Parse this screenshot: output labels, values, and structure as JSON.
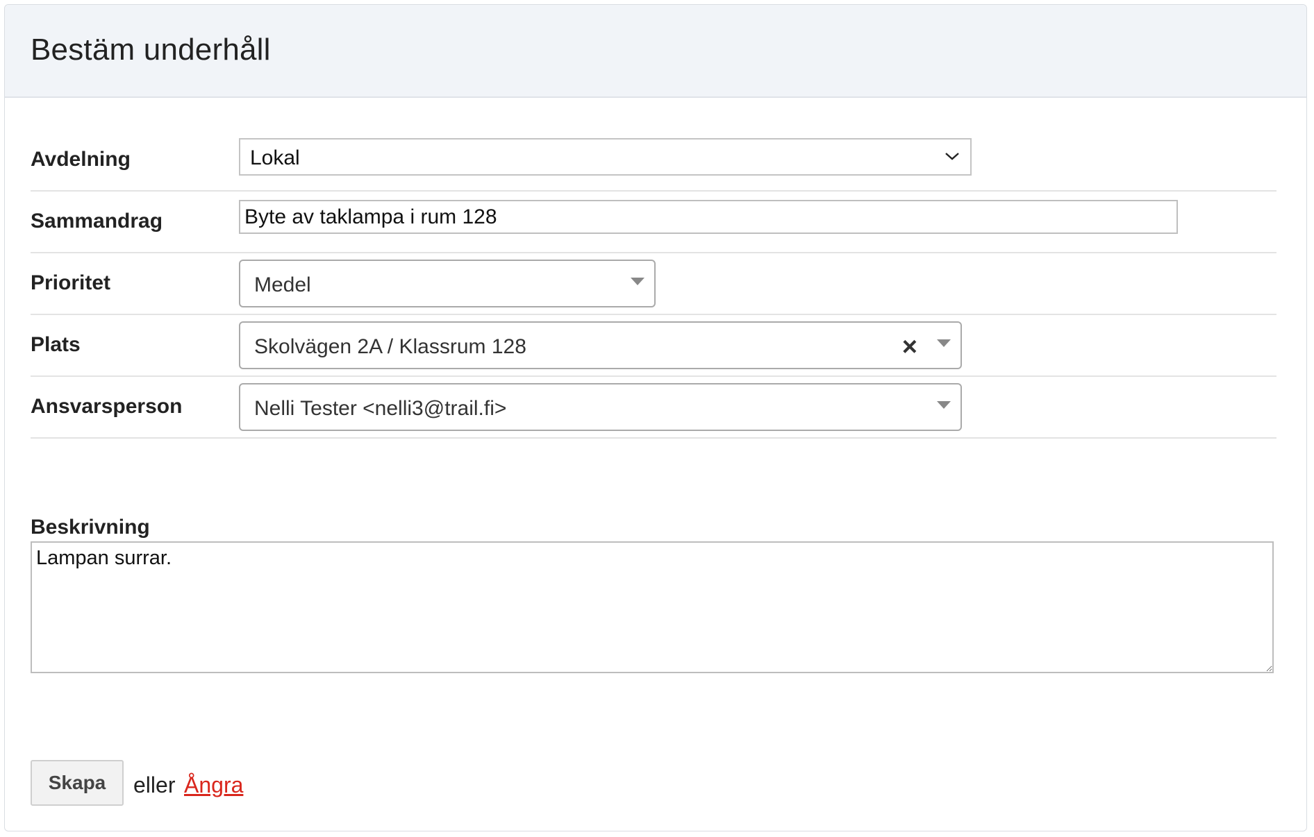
{
  "header": {
    "title": "Bestäm underhåll"
  },
  "form": {
    "department": {
      "label": "Avdelning",
      "selected": "Lokal"
    },
    "summary": {
      "label": "Sammandrag",
      "value": "Byte av taklampa i rum 128"
    },
    "priority": {
      "label": "Prioritet",
      "selected": "Medel"
    },
    "location": {
      "label": "Plats",
      "selected": "Skolvägen 2A / Klassrum 128",
      "clear_icon": "×"
    },
    "responsible": {
      "label": "Ansvarsperson",
      "selected": "Nelli Tester <nelli3@trail.fi>"
    },
    "description": {
      "label": "Beskrivning",
      "value": "Lampan surrar."
    }
  },
  "actions": {
    "create_label": "Skapa",
    "or_text": "eller",
    "cancel_label": "Ångra"
  },
  "colors": {
    "header_bg": "#f1f4f8",
    "link": "#d9261c",
    "button_bg": "#f2f2f2"
  }
}
